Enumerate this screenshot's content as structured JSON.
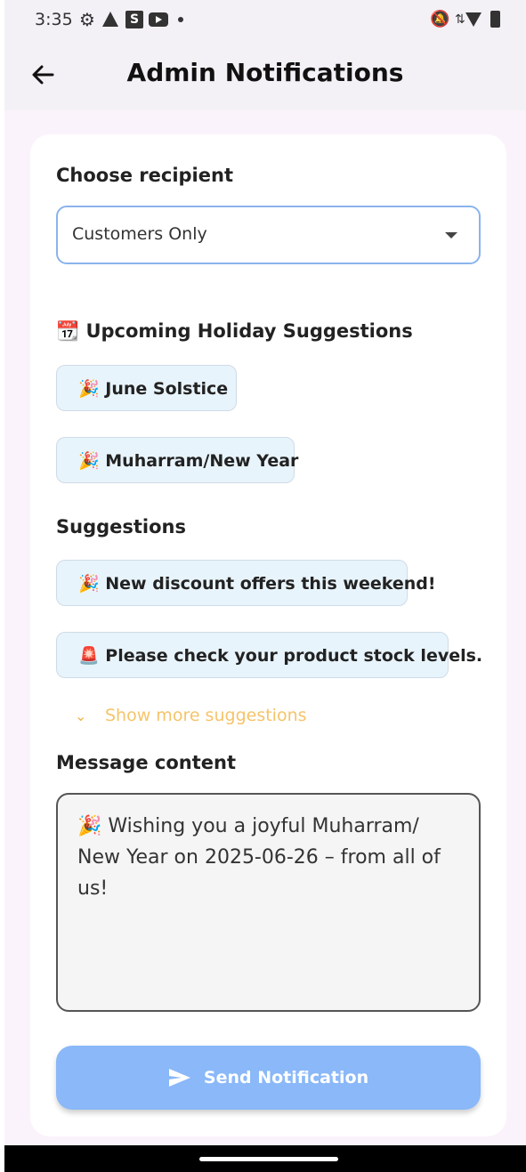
{
  "status_bar": {
    "time": "3:35",
    "icons": [
      "gear-icon",
      "warning-icon",
      "s-app-icon",
      "youtube-icon",
      "dot-icon",
      "bell-off-icon",
      "network-icon",
      "wifi-icon",
      "battery-icon"
    ],
    "s_icon_letter": "S"
  },
  "app_bar": {
    "title": "Admin Notifications",
    "back_icon": "arrow-left-icon"
  },
  "form": {
    "recipient_label": "Choose recipient",
    "recipient_value": "Customers Only",
    "holiday_heading": "📆 Upcoming Holiday Suggestions",
    "holiday_chips": [
      "🎉 June Solstice",
      "🎉 Muharram/New Year"
    ],
    "suggestions_heading": "Suggestions",
    "suggestion_chips": [
      "🎉 New discount offers this weekend!",
      "🚨 Please check your product stock levels."
    ],
    "show_more_label": "Show more suggestions",
    "message_label": "Message content",
    "message_value": "🎉 Wishing you a joyful Muharram/\nNew Year on 2025-06-26 – from all of us!",
    "send_label": "Send Notification"
  },
  "colors": {
    "accent": "#8ab8f8",
    "chip_bg": "#e8f4fb",
    "show_more": "#f5c46a",
    "background": "#fbf3fb"
  }
}
